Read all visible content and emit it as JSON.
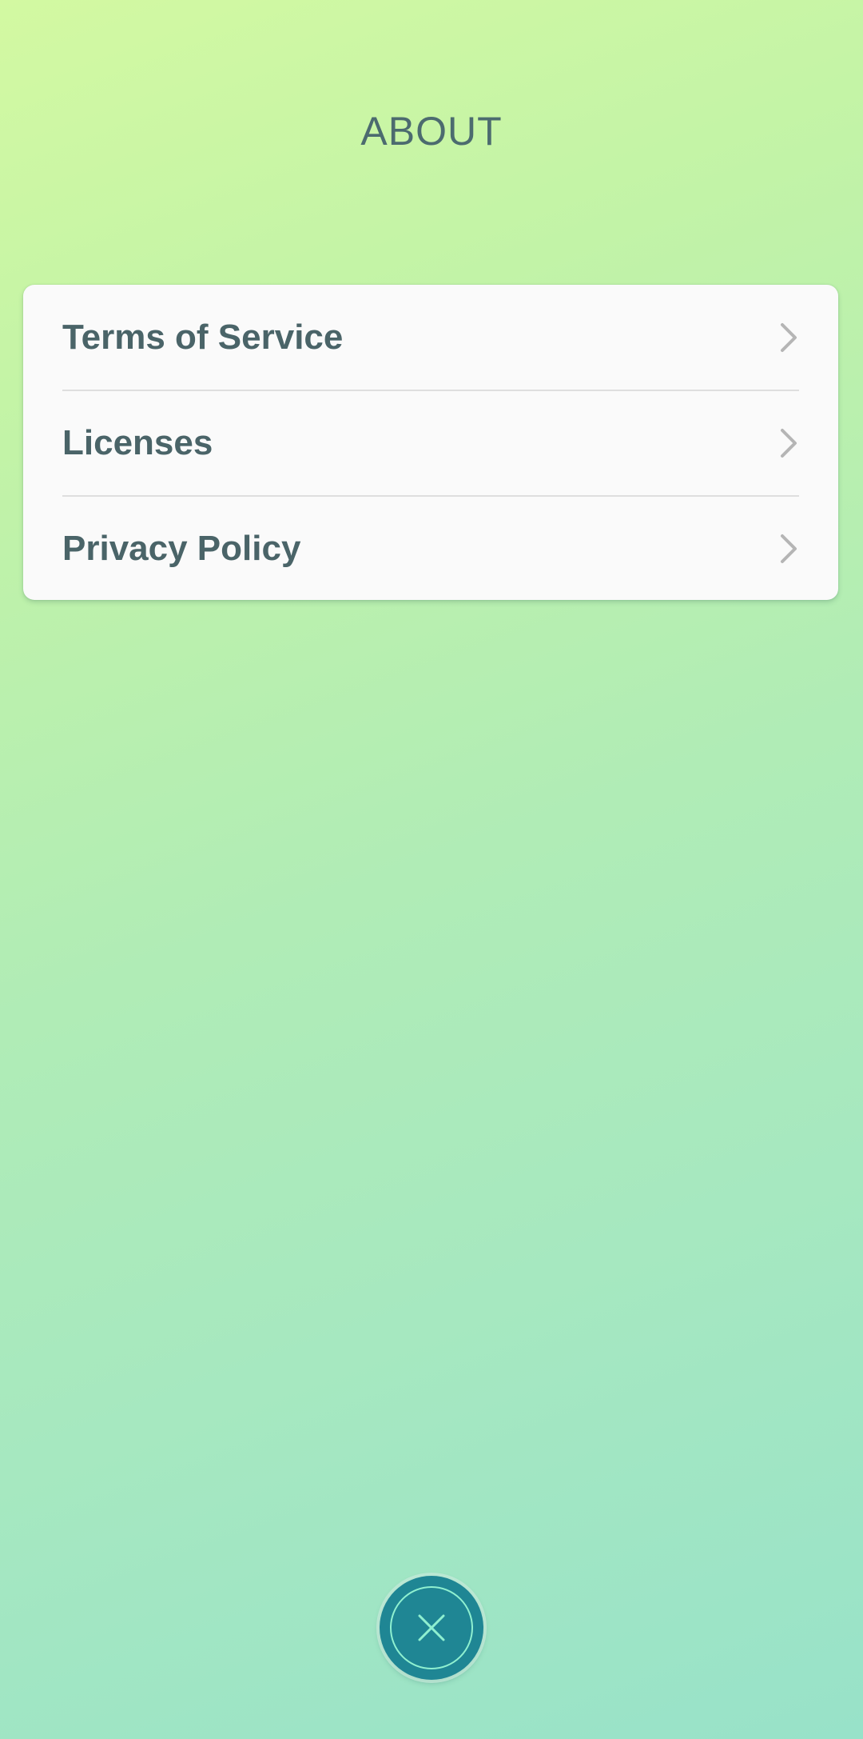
{
  "screen": {
    "title": "ABOUT"
  },
  "menu": {
    "items": [
      {
        "label": "Terms of Service",
        "icon": "chevron-right-icon"
      },
      {
        "label": "Licenses",
        "icon": "chevron-right-icon"
      },
      {
        "label": "Privacy Policy",
        "icon": "chevron-right-icon"
      }
    ]
  },
  "close_button": {
    "icon": "close-icon"
  },
  "colors": {
    "text": "#4a6468",
    "close_button_bg": "#1f8694",
    "close_ring": "#8ff0d0",
    "card_bg": "#fafafa"
  }
}
